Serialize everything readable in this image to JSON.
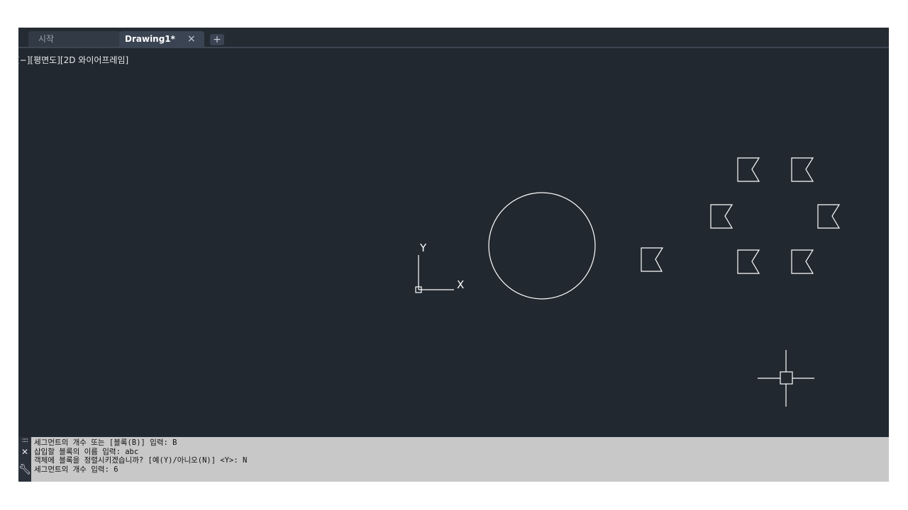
{
  "tabs": [
    {
      "label": "시작"
    },
    {
      "label": "Drawing1*"
    }
  ],
  "tab_add_label": "+",
  "tab_close_label": "×",
  "viewport_label": "[−][평면도][2D 와이어프레임]",
  "ucs": {
    "x_label": "X",
    "y_label": "Y"
  },
  "colors": {
    "background": "#212830",
    "lines": "#ffffff",
    "command_bg": "#c8c8c8"
  },
  "command_history": [
    "세그먼트의 개수 또는 [블록(B)] 입력: B",
    "삽입할 블록의 이름 입력: abc",
    "객체에 블록을 정렬시키겠습니까? [예(Y)/아니오(N)] <Y>: N",
    "세그먼트의 개수 입력: 6"
  ],
  "command_tools": {
    "grip_icon": "grip-icon",
    "close_icon": "close-icon",
    "customize_icon": "wrench-icon"
  }
}
